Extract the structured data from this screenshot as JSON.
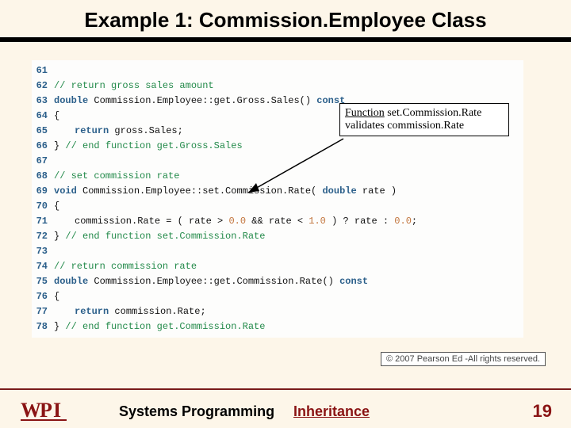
{
  "title": "Example 1: Commission.Employee Class",
  "callout": {
    "line1": "Function",
    "line1b": "set.Commission.Rate",
    "line2": "validates commission.Rate"
  },
  "code": {
    "l61": {
      "num": "61",
      "text": ""
    },
    "l62": {
      "num": "62",
      "comment": "// return gross sales amount"
    },
    "l63": {
      "num": "63",
      "kw": "double",
      "rest": " Commission.Employee::get.Gross.Sales() ",
      "kw2": "const"
    },
    "l64": {
      "num": "64",
      "text": "{"
    },
    "l65": {
      "num": "65",
      "kw": "return",
      "rest": " gross.Sales;"
    },
    "l66": {
      "num": "66",
      "text": "} ",
      "comment": "// end function get.Gross.Sales"
    },
    "l67": {
      "num": "67",
      "text": ""
    },
    "l68": {
      "num": "68",
      "comment": "// set commission rate"
    },
    "l69": {
      "num": "69",
      "kw": "void",
      "rest": " Commission.Employee::set.Commission.Rate( ",
      "kw2": "double",
      "rest2": " rate )"
    },
    "l70": {
      "num": "70",
      "text": "{"
    },
    "l71": {
      "num": "71",
      "a": "commission.Rate = ( rate > ",
      "n1": "0.0",
      "b": " && rate < ",
      "n2": "1.0",
      "c": " ) ? rate : ",
      "n3": "0.0",
      "d": ";"
    },
    "l72": {
      "num": "72",
      "text": "} ",
      "comment": "// end function set.Commission.Rate"
    },
    "l73": {
      "num": "73",
      "text": ""
    },
    "l74": {
      "num": "74",
      "comment": "// return commission rate"
    },
    "l75": {
      "num": "75",
      "kw": "double",
      "rest": " Commission.Employee::get.Commission.Rate() ",
      "kw2": "const"
    },
    "l76": {
      "num": "76",
      "text": "{"
    },
    "l77": {
      "num": "77",
      "kw": "return",
      "rest": " commission.Rate;"
    },
    "l78": {
      "num": "78",
      "text": "} ",
      "comment": "// end function get.Commission.Rate"
    }
  },
  "copyright": "© 2007 Pearson Ed -All rights reserved.",
  "footer": {
    "center": "Systems Programming",
    "topic": "Inheritance",
    "page": "19"
  }
}
